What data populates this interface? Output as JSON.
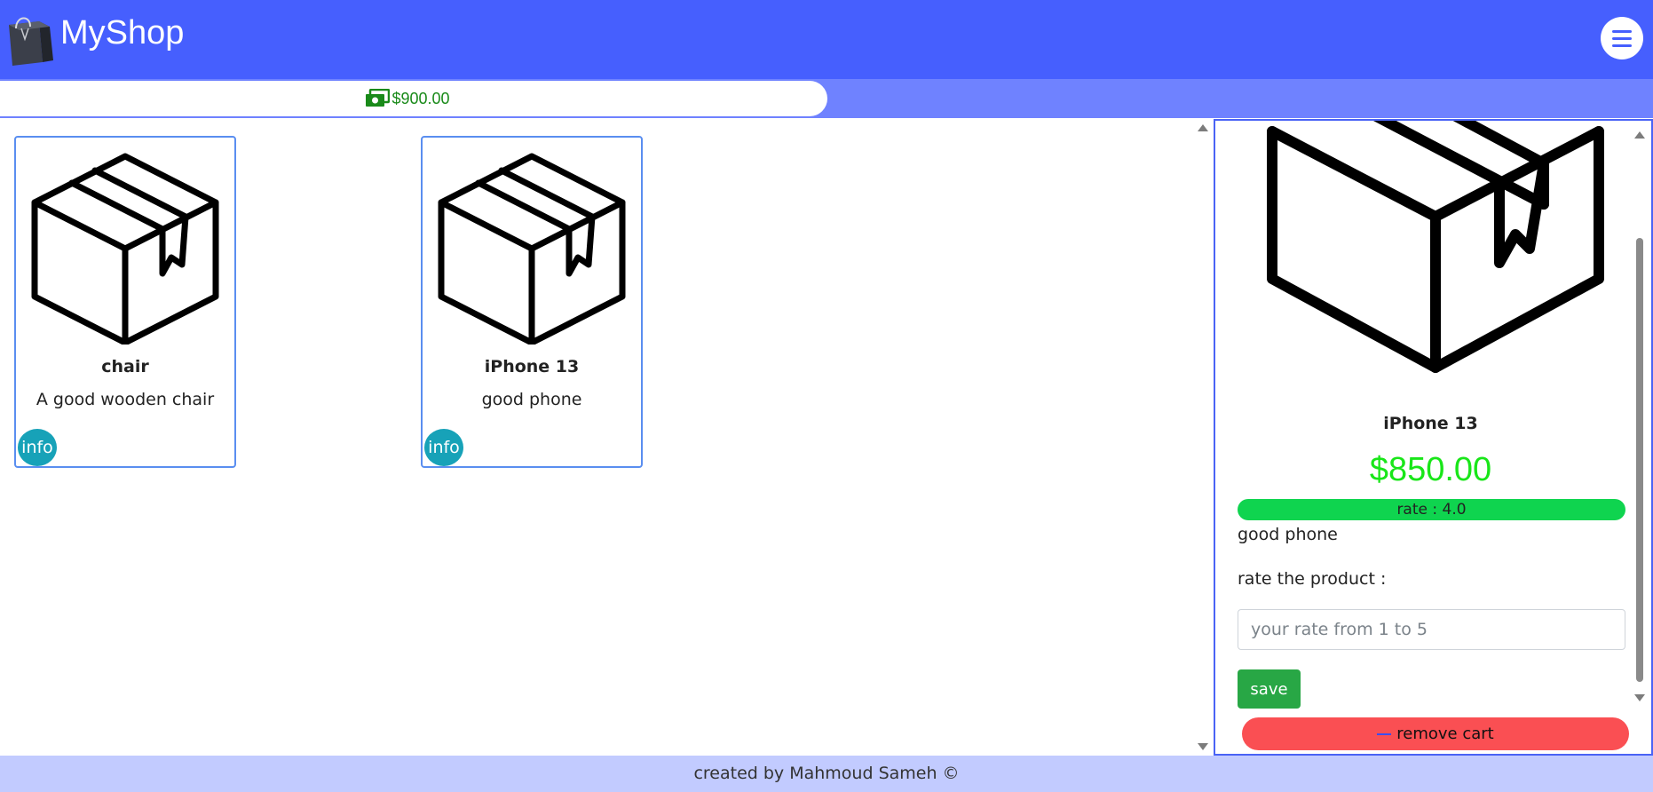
{
  "navbar": {
    "brand": "MyShop",
    "logo_icon": "shopping-bag-icon",
    "menu_icon": "hamburger-menu-icon"
  },
  "balance": {
    "icon": "money-bill-icon",
    "amount": "$900.00"
  },
  "products": [
    {
      "title": "chair",
      "description": "A good wooden chair",
      "info_label": "info",
      "image_icon": "box-icon"
    },
    {
      "title": "iPhone 13",
      "description": "good phone",
      "info_label": "info",
      "image_icon": "box-icon"
    }
  ],
  "detail": {
    "image_icon": "box-icon",
    "title": "iPhone 13",
    "price": "$850.00",
    "rate_text": "rate : 4.0",
    "description": "good phone",
    "rate_label": "rate the product :",
    "rate_placeholder": "your rate from 1 to 5",
    "save_label": "save",
    "remove_label": "remove cart",
    "remove_icon": "minus-icon"
  },
  "footer": {
    "text": "created by Mahmoud Sameh ©"
  },
  "colors": {
    "navbar": "#465ffe",
    "subbar": "#6f82ff",
    "footer": "#c2cbff",
    "price": "#19e619",
    "rate_bar": "#0fd44f",
    "save": "#28a745",
    "remove": "#fa4f53",
    "info": "#17a2b8"
  }
}
